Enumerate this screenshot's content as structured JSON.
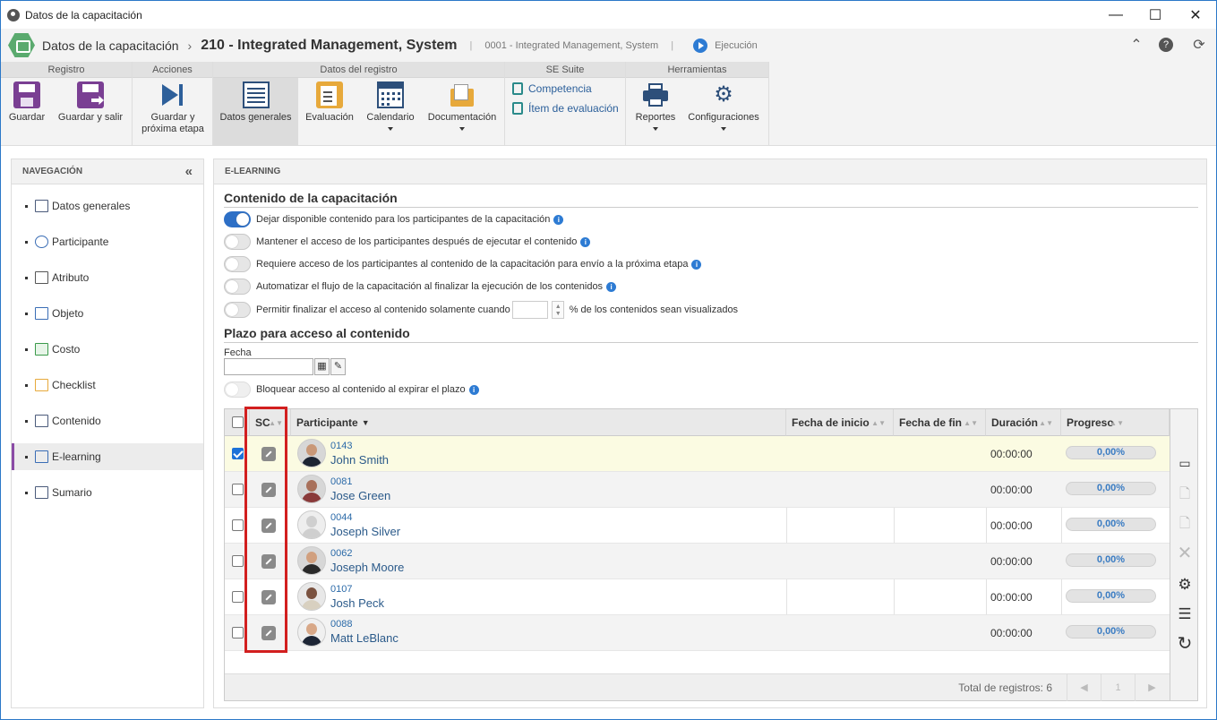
{
  "window": {
    "title": "Datos de la capacitación",
    "minimize": "—",
    "maximize": "☐",
    "close": "✕"
  },
  "header": {
    "app_name": "Datos de la capacitación",
    "record_title": "210 - Integrated Management, System",
    "sub_record": "0001 - Integrated Management, System",
    "status": "Ejecución"
  },
  "ribbon": {
    "groups": {
      "registro": "Registro",
      "acciones": "Acciones",
      "datos_registro": "Datos del registro",
      "se_suite": "SE Suite",
      "herramientas": "Herramientas"
    },
    "buttons": {
      "guardar": "Guardar",
      "guardar_salir": "Guardar y salir",
      "guardar_proxima_1": "Guardar y",
      "guardar_proxima_2": "próxima etapa",
      "datos_generales": "Datos generales",
      "evaluacion": "Evaluación",
      "calendario": "Calendario",
      "documentacion": "Documentación",
      "competencia": "Competencia",
      "item_evaluacion": "Ítem de evaluación",
      "reportes": "Reportes",
      "configuraciones": "Configuraciones"
    }
  },
  "nav": {
    "title": "NAVEGACIÓN",
    "items": [
      {
        "label": "Datos generales"
      },
      {
        "label": "Participante"
      },
      {
        "label": "Atributo"
      },
      {
        "label": "Objeto"
      },
      {
        "label": "Costo"
      },
      {
        "label": "Checklist"
      },
      {
        "label": "Contenido"
      },
      {
        "label": "E-learning"
      },
      {
        "label": "Sumario"
      }
    ],
    "active": "E-learning"
  },
  "main": {
    "title": "E-LEARNING",
    "section1": "Contenido de la capacitación",
    "toggles": [
      {
        "label": "Dejar disponible contenido para los participantes de la capacitación",
        "on": true
      },
      {
        "label": "Mantener el acceso de los participantes después de ejecutar el contenido",
        "on": false
      },
      {
        "label": "Requiere acceso de los participantes al contenido de la capacitación para envío a la próxima etapa",
        "on": false
      },
      {
        "label": "Automatizar el flujo de la capacitación al finalizar la ejecución de los contenidos",
        "on": false
      }
    ],
    "percent_toggle": {
      "before": "Permitir finalizar el acceso al contenido solamente cuando",
      "value": "",
      "after": "% de los contenidos sean visualizados"
    },
    "section2": "Plazo para acceso al contenido",
    "fecha_label": "Fecha",
    "fecha_value": "",
    "block_toggle": "Bloquear acceso al contenido al expirar el plazo"
  },
  "grid": {
    "columns": {
      "sc": "SC",
      "participante": "Participante",
      "fecha_inicio": "Fecha de inicio",
      "fecha_fin": "Fecha de fin",
      "duracion": "Duración",
      "progreso": "Progreso"
    },
    "rows": [
      {
        "id": "0143",
        "name": "John Smith",
        "start": "",
        "end": "",
        "duration": "00:00:00",
        "progress": "0,00%",
        "checked": true
      },
      {
        "id": "0081",
        "name": "Jose Green",
        "start": "",
        "end": "",
        "duration": "00:00:00",
        "progress": "0,00%",
        "checked": false
      },
      {
        "id": "0044",
        "name": "Joseph Silver",
        "start": "",
        "end": "",
        "duration": "00:00:00",
        "progress": "0,00%",
        "checked": false
      },
      {
        "id": "0062",
        "name": "Joseph Moore",
        "start": "",
        "end": "",
        "duration": "00:00:00",
        "progress": "0,00%",
        "checked": false
      },
      {
        "id": "0107",
        "name": "Josh Peck",
        "start": "",
        "end": "",
        "duration": "00:00:00",
        "progress": "0,00%",
        "checked": false
      },
      {
        "id": "0088",
        "name": "Matt LeBlanc",
        "start": "",
        "end": "",
        "duration": "00:00:00",
        "progress": "0,00%",
        "checked": false
      }
    ],
    "total": "Total de registros: 6",
    "page": "1",
    "prev": "◀",
    "next": "▶"
  },
  "side_icons": [
    "view-icon",
    "add-file-icon",
    "remove-file-icon",
    "delete-icon",
    "settings-icon",
    "list-icon",
    "refresh-icon"
  ],
  "colors": {
    "accent": "#2d6fc6",
    "highlight_box": "#d21f1f",
    "nav_active": "#8a4ba6"
  }
}
